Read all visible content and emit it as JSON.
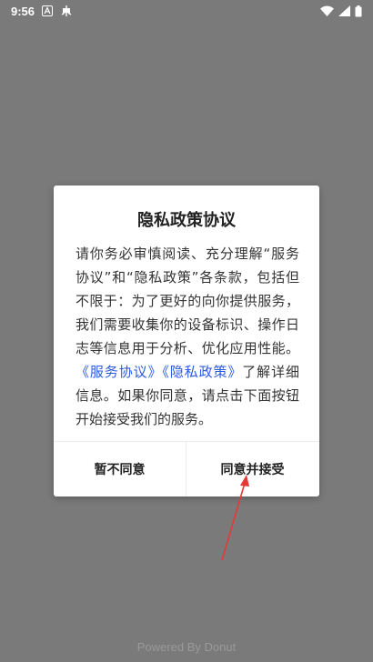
{
  "status_bar": {
    "time": "9:56",
    "app_icons": [
      "a-icon",
      "bug-icon"
    ],
    "system_icons": [
      "wifi-icon",
      "signal-icon",
      "battery-icon"
    ]
  },
  "dialog": {
    "title": "隐私政策协议",
    "body_text_1": "请你务必审慎阅读、充分理解“服务协议”和“隐私政策”各条款，包括但不限于：为了更好的向你提供服务，我们需要收集你的设备标识、操作日志等信息用于分析、优化应用性能。",
    "link_service": "《服务协议》",
    "link_privacy": "《隐私政策》",
    "body_text_2": "了解详细信息。如果你同意，请点击下面按钮开始接受我们的服务。",
    "decline_label": "暂不同意",
    "accept_label": "同意并接受"
  },
  "footer": {
    "text": "Powered By Donut"
  },
  "colors": {
    "overlay_bg": "#7a7a7a",
    "link": "#2b5be0",
    "annotation_arrow": "#e53935"
  }
}
